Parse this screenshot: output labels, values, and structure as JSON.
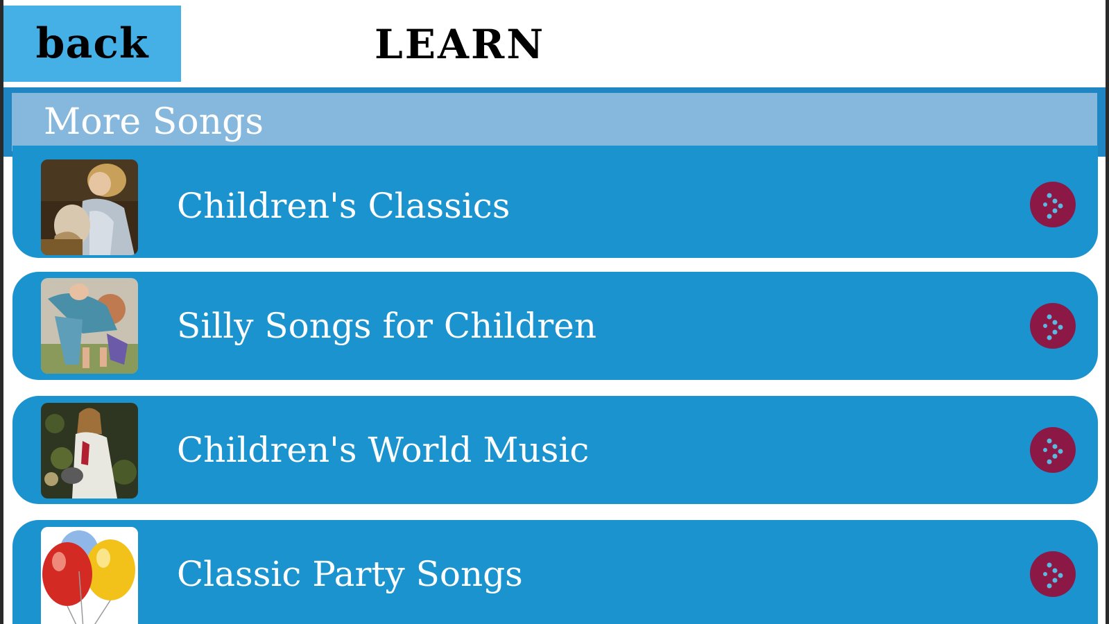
{
  "header": {
    "back_label": "back",
    "title": "LEARN"
  },
  "section": {
    "label": "More Songs"
  },
  "items": [
    {
      "label": "Children's Classics",
      "thumbnail": "girl-with-lamb-painting"
    },
    {
      "label": "Silly Songs for Children",
      "thumbnail": "mother-and-child-painting"
    },
    {
      "label": "Children's World Music",
      "thumbnail": "girl-in-white-dress-painting"
    },
    {
      "label": "Classic Party Songs",
      "thumbnail": "balloons"
    }
  ],
  "icons": {
    "detail": "disclosure-arrow-icon"
  },
  "colors": {
    "back_button": "#45b0e6",
    "section_bar": "#1f86c3",
    "section_inner": "#86b7dc",
    "row": "#1a93cf",
    "detail_button": "#8c1846",
    "detail_dots": "#5bb9e0"
  }
}
